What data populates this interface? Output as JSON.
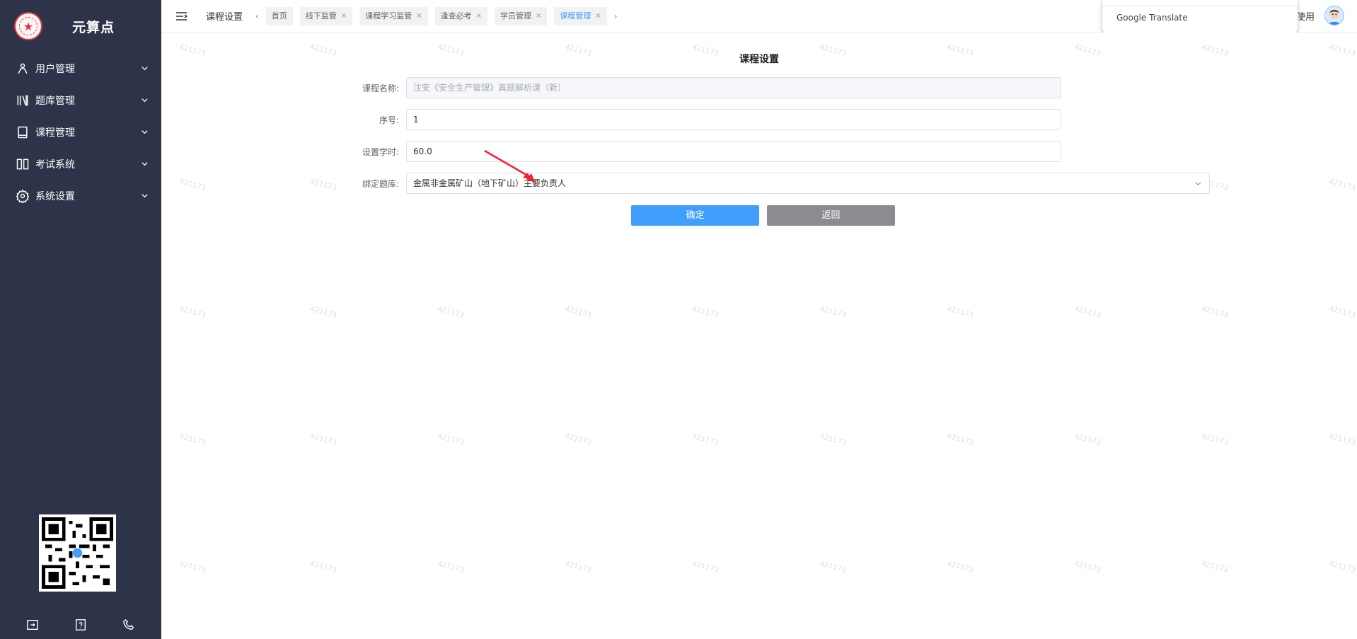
{
  "sidebar": {
    "brand": "元算点",
    "menu": [
      {
        "label": "用户管理",
        "icon": "users-icon"
      },
      {
        "label": "题库管理",
        "icon": "library-icon"
      },
      {
        "label": "课程管理",
        "icon": "book-icon"
      },
      {
        "label": "考试系统",
        "icon": "exam-icon"
      },
      {
        "label": "系统设置",
        "icon": "gear-icon"
      }
    ],
    "footer_icons": [
      "exit-icon",
      "help-icon",
      "phone-icon"
    ]
  },
  "header": {
    "title": "课程设置",
    "tabs": [
      {
        "label": "首页",
        "closable": false,
        "active": false
      },
      {
        "label": "线下监管",
        "closable": true,
        "active": false
      },
      {
        "label": "课程学习监管",
        "closable": true,
        "active": false
      },
      {
        "label": "逢查必考",
        "closable": true,
        "active": false
      },
      {
        "label": "学员管理",
        "closable": true,
        "active": false
      },
      {
        "label": "课程管理",
        "closable": true,
        "active": true
      }
    ],
    "user_label": "使用",
    "translate_popup": "Google Translate"
  },
  "form": {
    "title": "课程设置",
    "course_name_label": "课程名称:",
    "course_name_value": "注安《安全生产管理》真题解析课（新）",
    "serial_label": "序号:",
    "serial_value": "1",
    "hours_label": "设置学时:",
    "hours_value": "60.0",
    "bank_label": "绑定题库:",
    "bank_value": "金属非金属矿山（地下矿山）主要负责人",
    "confirm_label": "确定",
    "back_label": "返回"
  },
  "watermark_text": "421173",
  "colors": {
    "sidebar_bg": "#2d3449",
    "primary": "#409eff",
    "back_button": "#8b8c90",
    "arrow": "#f5222d"
  }
}
